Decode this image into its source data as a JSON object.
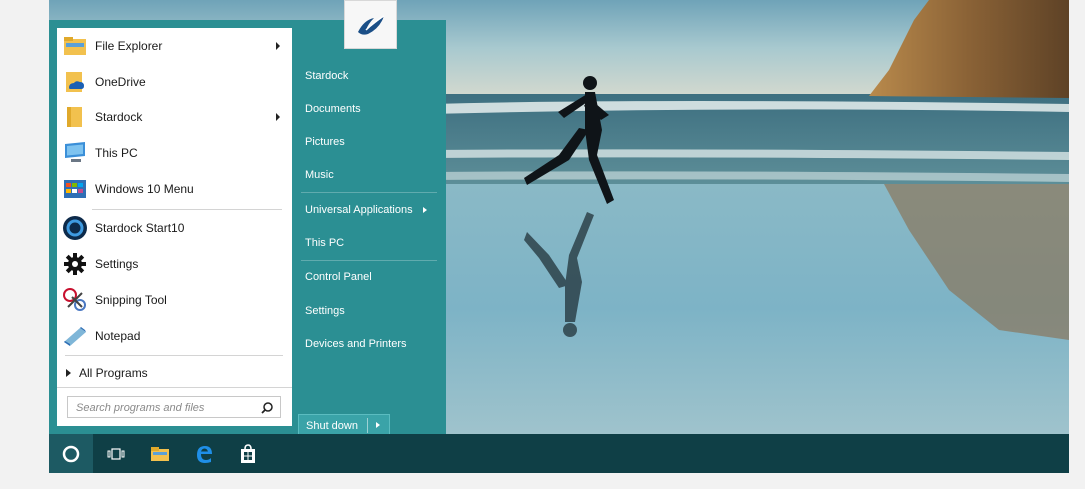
{
  "start_menu": {
    "left_items": [
      {
        "label": "File Explorer",
        "icon": "folder-explorer-icon",
        "has_submenu": true
      },
      {
        "label": "OneDrive",
        "icon": "onedrive-icon",
        "has_submenu": false
      },
      {
        "label": "Stardock",
        "icon": "folder-icon",
        "has_submenu": true
      },
      {
        "label": "This PC",
        "icon": "computer-icon",
        "has_submenu": false
      },
      {
        "label": "Windows 10 Menu",
        "icon": "windows-menu-icon",
        "has_submenu": false
      },
      {
        "label": "Stardock Start10",
        "icon": "start10-icon",
        "has_submenu": false
      },
      {
        "label": "Settings",
        "icon": "gear-icon",
        "has_submenu": false
      },
      {
        "label": "Snipping Tool",
        "icon": "scissors-icon",
        "has_submenu": false
      },
      {
        "label": "Notepad",
        "icon": "notepad-icon",
        "has_submenu": false
      }
    ],
    "all_programs_label": "All Programs",
    "search_placeholder": "Search programs and files",
    "right_items": [
      {
        "label": "Stardock",
        "has_submenu": false
      },
      {
        "label": "Documents",
        "has_submenu": false
      },
      {
        "label": "Pictures",
        "has_submenu": false
      },
      {
        "label": "Music",
        "has_submenu": false
      },
      {
        "label": "Universal Applications",
        "has_submenu": true
      },
      {
        "label": "This PC",
        "has_submenu": false
      },
      {
        "label": "Control Panel",
        "has_submenu": false
      },
      {
        "label": "Settings",
        "has_submenu": false
      },
      {
        "label": "Devices and Printers",
        "has_submenu": false
      }
    ],
    "shutdown_label": "Shut down",
    "logo_icon": "stardock-logo-icon"
  },
  "taskbar": {
    "items": [
      "start-button-icon",
      "task-view-icon",
      "file-explorer-icon",
      "edge-icon",
      "store-icon"
    ]
  },
  "colors": {
    "panel_teal": "#2b8f93",
    "taskbar": "#0f3f46",
    "shutdown": "#3aa3a8"
  }
}
